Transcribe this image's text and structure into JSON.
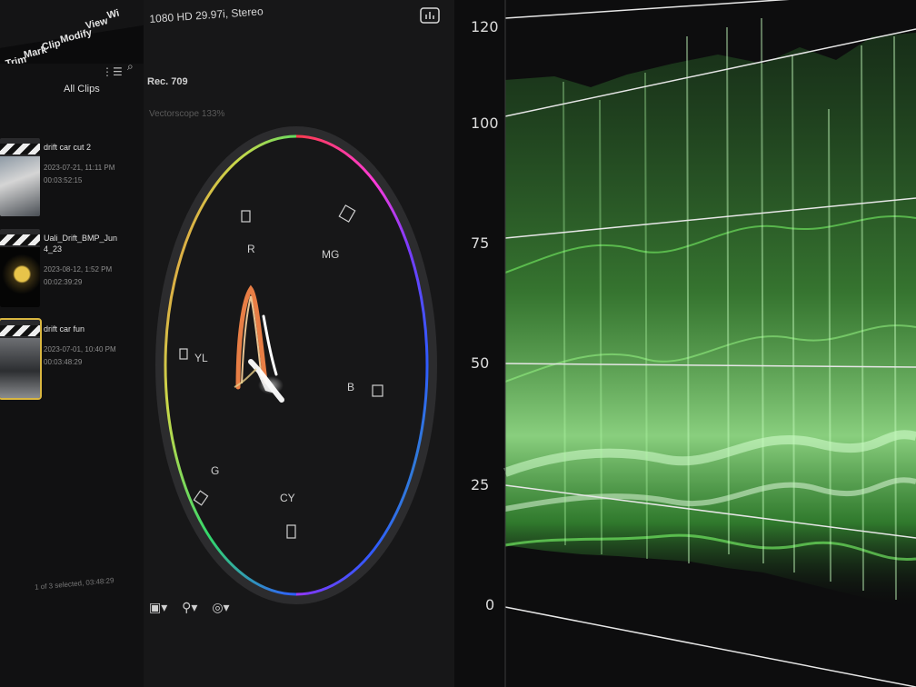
{
  "menu": {
    "items": [
      "Trim",
      "Mark",
      "Clip",
      "Modify",
      "View",
      "Wi"
    ]
  },
  "browser": {
    "filter_label": "All Clips",
    "clips": [
      {
        "name": "drift car cut 2",
        "date": "2023-07-21, 11:11 PM",
        "duration": "00:03:52:15",
        "selected": false
      },
      {
        "name": "Uali_Drift_BMP_Jun 4_23",
        "date": "2023-08-12, 1:52 PM",
        "duration": "00:02:39:29",
        "selected": false
      },
      {
        "name": "drift car fun",
        "date": "2023-07-01, 10:40 PM",
        "duration": "00:03:48:29",
        "selected": true
      }
    ],
    "status": "1 of 3 selected, 03:48:29"
  },
  "vectorscope": {
    "format": "1080 HD 29.97i, Stereo",
    "color_space": "Rec. 709",
    "caption": "Vectorscope 133%",
    "targets": [
      "R",
      "MG",
      "B",
      "CY",
      "G",
      "YL"
    ]
  },
  "waveform": {
    "scale_labels": [
      "120",
      "100",
      "75",
      "50",
      "25",
      "0"
    ]
  },
  "colors": {
    "background": "#0b0b0c",
    "accent": "#d9b640",
    "trace": "#7dff6a"
  }
}
